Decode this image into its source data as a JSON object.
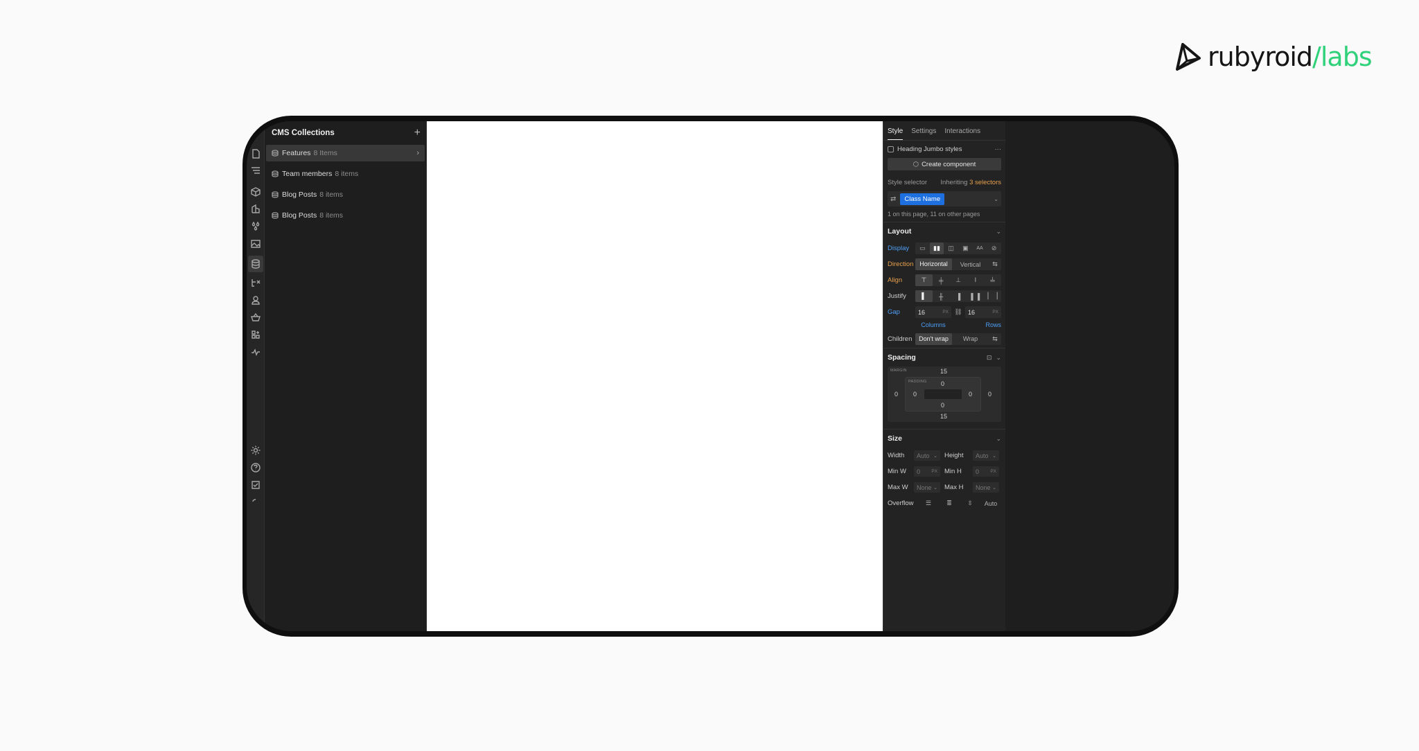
{
  "logo": {
    "name_dark": "rubyroid",
    "slash": "/",
    "name_green": "labs"
  },
  "cms": {
    "title": "CMS Collections",
    "add": "+",
    "items": [
      {
        "name": "Features",
        "count": "8 Items"
      },
      {
        "name": "Team members",
        "count": "8 items"
      },
      {
        "name": "Blog Posts",
        "count": "8 items"
      },
      {
        "name": "Blog Posts",
        "count": "8 items"
      }
    ]
  },
  "style_panel": {
    "tabs": [
      "Style",
      "Settings",
      "Interactions"
    ],
    "heading_styles": "Heading Jumbo styles",
    "more": "···",
    "create_component": "Create component",
    "style_selector_label": "Style selector",
    "inheriting_prefix": "Inheriting ",
    "inheriting_link": "3 selectors",
    "class_name": "Class Name",
    "selector_note": "1 on this page, 11 on other pages",
    "layout": {
      "title": "Layout",
      "display_label": "Display",
      "direction_label": "Direction",
      "direction_options": [
        "Horizontal",
        "Vertical"
      ],
      "align_label": "Align",
      "justify_label": "Justify",
      "gap_label": "Gap",
      "gap_columns": "16",
      "gap_rows": "16",
      "unit": "PX",
      "columns_label": "Columns",
      "rows_label": "Rows",
      "children_label": "Children",
      "children_options": [
        "Don't wrap",
        "Wrap"
      ]
    },
    "spacing": {
      "title": "Spacing",
      "margin_tag": "MARGIN",
      "padding_tag": "PADDING",
      "margin_top": "15",
      "margin_bottom": "15",
      "margin_left": "0",
      "margin_right": "0",
      "padding_top": "0",
      "padding_bottom": "0",
      "padding_left": "0",
      "padding_right": "0"
    },
    "size": {
      "title": "Size",
      "width_label": "Width",
      "width_value": "Auto",
      "height_label": "Height",
      "height_value": "Auto",
      "minw_label": "Min W",
      "minw_value": "0",
      "minh_label": "Min H",
      "minh_value": "0",
      "maxw_label": "Max W",
      "maxw_value": "None",
      "maxh_label": "Max H",
      "maxh_value": "None",
      "overflow_label": "Overflow",
      "overflow_auto": "Auto"
    }
  },
  "colors": {
    "accent_blue": "#1e6fe0",
    "brand_green": "#2fd17a",
    "label_orange": "#e8a04d",
    "label_blue": "#4f9ff6"
  }
}
